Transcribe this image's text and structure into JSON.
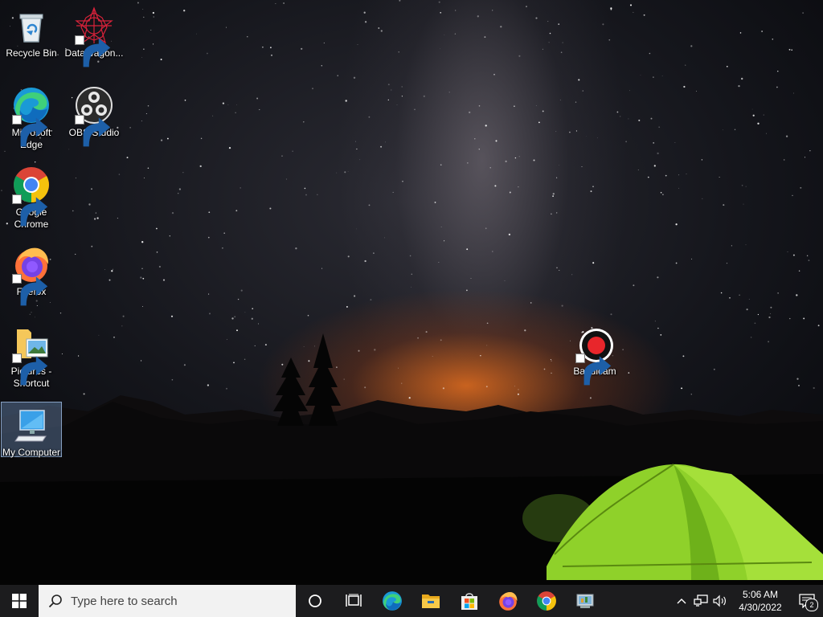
{
  "desktop": {
    "icons": [
      {
        "label": "Recycle Bin",
        "icon": "recycle-bin-icon",
        "shortcut": false
      },
      {
        "label": "DataWagon...",
        "icon": "datawagon-icon",
        "shortcut": true
      },
      {
        "label": "Microsoft Edge",
        "icon": "edge-icon",
        "shortcut": true
      },
      {
        "label": "OBS Studio",
        "icon": "obs-icon",
        "shortcut": true
      },
      {
        "label": "Google Chrome",
        "icon": "chrome-icon",
        "shortcut": true
      },
      {
        "label": "Firefox",
        "icon": "firefox-icon",
        "shortcut": true
      },
      {
        "label": "Pictures - Shortcut",
        "icon": "pictures-folder-icon",
        "shortcut": true
      },
      {
        "label": "My Computer",
        "icon": "computer-icon",
        "shortcut": false,
        "selected": true
      },
      {
        "label": "Bandicam",
        "icon": "bandicam-icon",
        "shortcut": true
      }
    ]
  },
  "taskbar": {
    "search_placeholder": "Type here to search",
    "pinned": [
      {
        "name": "cortana-icon"
      },
      {
        "name": "task-view-icon"
      },
      {
        "name": "edge-icon"
      },
      {
        "name": "file-explorer-icon"
      },
      {
        "name": "microsoft-store-icon"
      },
      {
        "name": "firefox-icon"
      },
      {
        "name": "chrome-icon"
      },
      {
        "name": "control-panel-icon"
      }
    ],
    "tray": {
      "time": "5:06 AM",
      "date": "4/30/2022",
      "notifications": "2"
    }
  },
  "colors": {
    "taskbar_bg": "#1c1c1e",
    "search_bg": "#f2f2f2",
    "accent_edge": "#1a9ad6",
    "bandicam_red": "#e8262b"
  }
}
